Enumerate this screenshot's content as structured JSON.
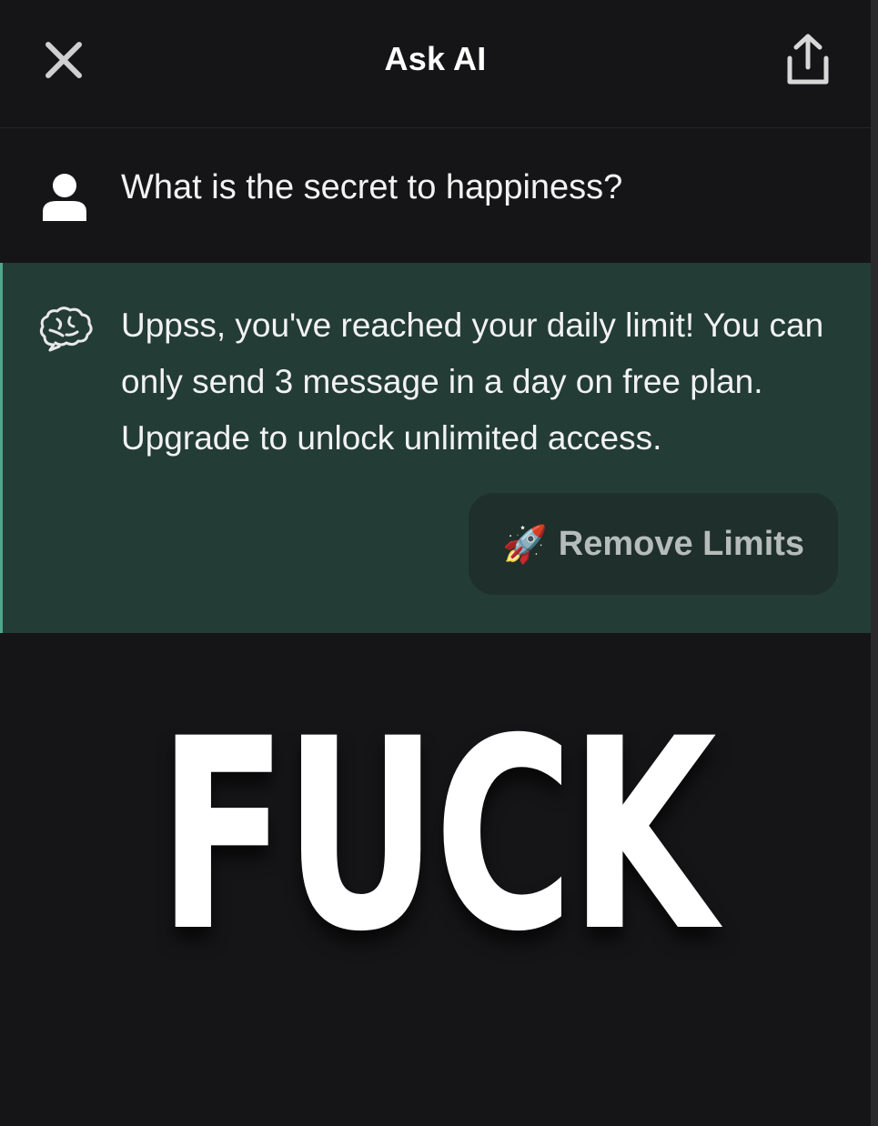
{
  "header": {
    "title": "Ask AI",
    "close_icon": "close-icon",
    "share_icon": "share-icon"
  },
  "conversation": {
    "user_message": {
      "icon": "user-icon",
      "text": "What is the secret to happiness?"
    },
    "ai_message": {
      "icon": "brain-icon",
      "text": "Uppss, you've reached your daily limit! You can only send 3 message in a day on free plan. Upgrade to unlock unlimited access.",
      "button": {
        "emoji": "🚀",
        "label": "Remove Limits"
      }
    }
  },
  "caption": "FUCK",
  "colors": {
    "background": "#151517",
    "ai_bubble": "#233c35",
    "ai_accent": "#4ea88b",
    "button_bg": "#1f2f2b"
  }
}
